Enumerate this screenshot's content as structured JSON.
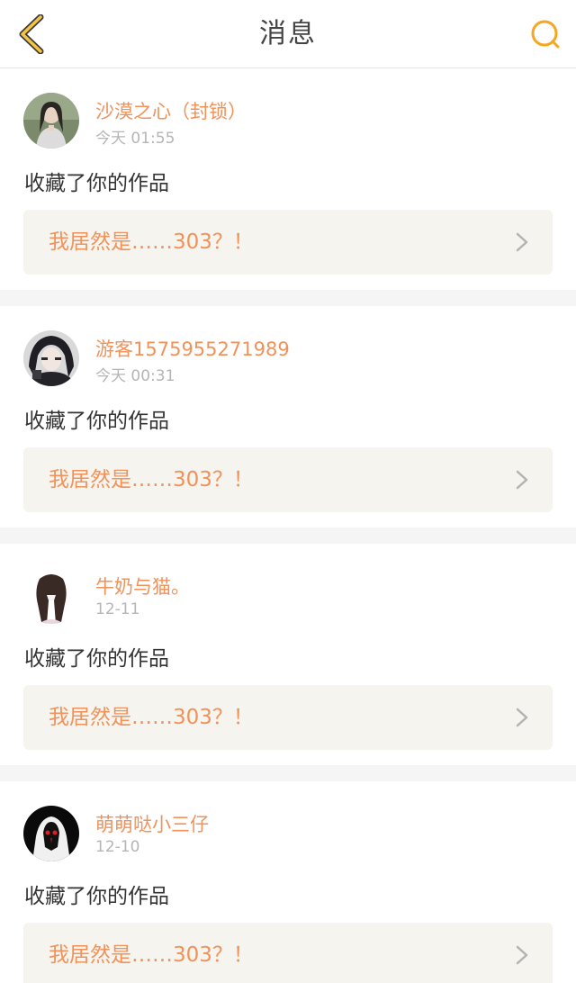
{
  "header": {
    "title": "消息",
    "back_icon": "chevron-left-icon",
    "search_icon": "search-icon",
    "accent_color": "#f5a623"
  },
  "colors": {
    "username": "#f0925a",
    "work_title": "#f0925a",
    "work_box_bg": "#f5f4ee",
    "time": "#b5b5b5"
  },
  "messages": [
    {
      "username": "沙漠之心（封锁）",
      "time": "今天 01:55",
      "action": "收藏了你的作品",
      "work_title": "我居然是……303？！",
      "avatar_icon": "user-avatar-photo"
    },
    {
      "username": "游客1575955271989",
      "time": "今天 00:31",
      "action": "收藏了你的作品",
      "work_title": "我居然是……303？！",
      "avatar_icon": "user-avatar-anime"
    },
    {
      "username": "牛奶与猫。",
      "time": "12-11",
      "action": "收藏了你的作品",
      "work_title": "我居然是……303？！",
      "avatar_icon": "user-avatar-girl"
    },
    {
      "username": "萌萌哒小三仔",
      "time": "12-10",
      "action": "收藏了你的作品",
      "work_title": "我居然是……303？！",
      "avatar_icon": "user-avatar-mask"
    }
  ]
}
